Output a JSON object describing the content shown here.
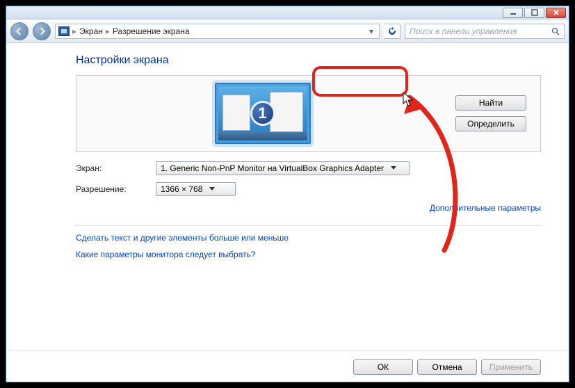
{
  "breadcrumb": {
    "items": [
      "Экран",
      "Разрешение экрана"
    ]
  },
  "search": {
    "placeholder": "Поиск в панели управления"
  },
  "page": {
    "title": "Настройки экрана"
  },
  "monitor_panel": {
    "badge_number": "1",
    "find_label": "Найти",
    "identify_label": "Определить"
  },
  "form": {
    "display_label": "Экран:",
    "display_value": "1. Generic Non-PnP Monitor на VirtualBox Graphics Adapter",
    "resolution_label": "Разрешение:",
    "resolution_value": "1366 × 768"
  },
  "advanced_link": "Дополнительные параметры",
  "links": {
    "text_size": "Сделать текст и другие элементы больше или меньше",
    "which_monitor": "Какие параметры монитора следует выбрать?"
  },
  "buttons": {
    "ok": "ОК",
    "cancel": "Отмена",
    "apply": "Применить"
  },
  "annotation": {
    "highlight": "find-button"
  }
}
